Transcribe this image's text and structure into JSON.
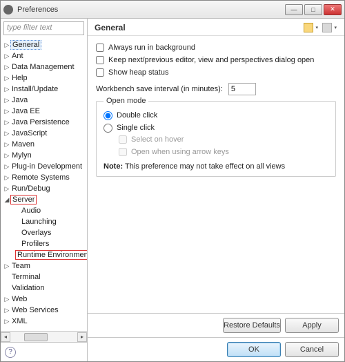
{
  "window": {
    "title": "Preferences"
  },
  "filter": {
    "placeholder": "type filter text"
  },
  "tree": {
    "general": "General",
    "ant": "Ant",
    "data_management": "Data Management",
    "help": "Help",
    "install_update": "Install/Update",
    "java": "Java",
    "java_ee": "Java EE",
    "java_persistence": "Java Persistence",
    "javascript": "JavaScript",
    "maven": "Maven",
    "mylyn": "Mylyn",
    "plugin_dev": "Plug-in Development",
    "remote_systems": "Remote Systems",
    "run_debug": "Run/Debug",
    "server": "Server",
    "server_children": {
      "audio": "Audio",
      "launching": "Launching",
      "overlays": "Overlays",
      "profilers": "Profilers",
      "runtime_env": "Runtime Environment"
    },
    "team": "Team",
    "terminal": "Terminal",
    "validation": "Validation",
    "web": "Web",
    "web_services": "Web Services",
    "xml": "XML"
  },
  "page": {
    "title": "General",
    "always_run_bg": "Always run in background",
    "keep_next_prev": "Keep next/previous editor, view and perspectives dialog open",
    "show_heap": "Show heap status",
    "save_interval_label": "Workbench save interval (in minutes):",
    "save_interval_value": "5",
    "open_mode_title": "Open mode",
    "double_click": "Double click",
    "single_click": "Single click",
    "select_hover": "Select on hover",
    "open_arrow": "Open when using arrow keys",
    "note_label": "Note:",
    "note_text": "This preference may not take effect on all views"
  },
  "buttons": {
    "restore": "Restore Defaults",
    "apply": "Apply",
    "ok": "OK",
    "cancel": "Cancel"
  }
}
